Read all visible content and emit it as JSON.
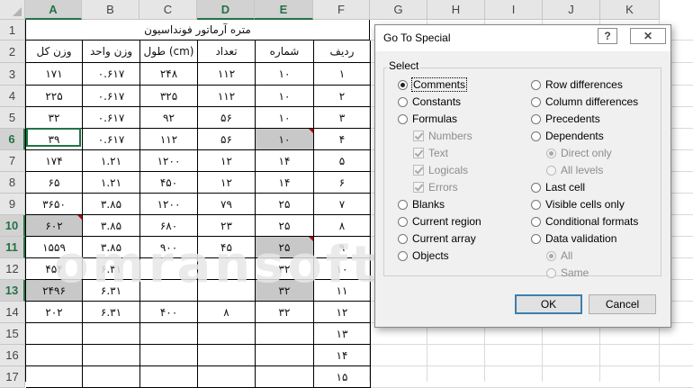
{
  "columns": [
    "A",
    "B",
    "C",
    "D",
    "E",
    "F",
    "G",
    "H",
    "I",
    "J",
    "K"
  ],
  "selected_columns": [
    "A",
    "D",
    "E"
  ],
  "rows": [
    "1",
    "2",
    "3",
    "4",
    "5",
    "6",
    "7",
    "8",
    "9",
    "10",
    "11",
    "12",
    "13",
    "14",
    "15",
    "16",
    "17"
  ],
  "selected_rows": [
    "6",
    "10",
    "11",
    "13"
  ],
  "sheet": {
    "title": "متره آرماتور فونداسیون",
    "headers": [
      "وزن کل",
      "وزن واحد",
      "طول (cm)",
      "تعداد",
      "شماره",
      "ردیف"
    ],
    "data": [
      [
        "۱۷۱",
        "۰.۶۱۷",
        "۲۴۸",
        "۱۱۲",
        "۱۰",
        "۱"
      ],
      [
        "۲۲۵",
        "۰.۶۱۷",
        "۳۲۵",
        "۱۱۲",
        "۱۰",
        "۲"
      ],
      [
        "۳۲",
        "۰.۶۱۷",
        "۹۲",
        "۵۶",
        "۱۰",
        "۳"
      ],
      [
        "۳۹",
        "۰.۶۱۷",
        "۱۱۲",
        "۵۶",
        "۱۰",
        "۴"
      ],
      [
        "۱۷۴",
        "۱.۲۱",
        "۱۲۰۰",
        "۱۲",
        "۱۴",
        "۵"
      ],
      [
        "۶۵",
        "۱.۲۱",
        "۴۵۰",
        "۱۲",
        "۱۴",
        "۶"
      ],
      [
        "۳۶۵۰",
        "۳.۸۵",
        "۱۲۰۰",
        "۷۹",
        "۲۵",
        "۷"
      ],
      [
        "۶۰۲",
        "۳.۸۵",
        "۶۸۰",
        "۲۳",
        "۲۵",
        "۸"
      ],
      [
        "۱۵۵۹",
        "۳.۸۵",
        "۹۰۰",
        "۴۵",
        "۲۵",
        "۹"
      ],
      [
        "۴۵۴",
        "۶.۳۱",
        "",
        "",
        "۳۲",
        "۱۰"
      ],
      [
        "۲۴۹۶",
        "۶.۳۱",
        "",
        "",
        "۳۲",
        "۱۱"
      ],
      [
        "۲۰۲",
        "۶.۳۱",
        "۴۰۰",
        "۸",
        "۳۲",
        "۱۲"
      ],
      [
        "",
        "",
        "",
        "",
        "",
        "۱۳"
      ],
      [
        "",
        "",
        "",
        "",
        "",
        "۱۴"
      ],
      [
        "",
        "",
        "",
        "",
        "",
        "۱۵"
      ]
    ]
  },
  "watermark": "omransoft.ir",
  "dialog": {
    "title": "Go To Special",
    "help_icon": "?",
    "close_icon": "✕",
    "group_label": "Select",
    "left_options": [
      {
        "label": "Comments",
        "state": "selected"
      },
      {
        "label": "Constants",
        "state": "normal"
      },
      {
        "label": "Formulas",
        "state": "normal"
      },
      {
        "label": "Numbers",
        "state": "checkbox-disabled"
      },
      {
        "label": "Text",
        "state": "checkbox-disabled"
      },
      {
        "label": "Logicals",
        "state": "checkbox-disabled"
      },
      {
        "label": "Errors",
        "state": "checkbox-disabled"
      },
      {
        "label": "Blanks",
        "state": "normal"
      },
      {
        "label": "Current region",
        "state": "normal"
      },
      {
        "label": "Current array",
        "state": "normal"
      },
      {
        "label": "Objects",
        "state": "normal"
      }
    ],
    "right_options": [
      {
        "label": "Row differences",
        "state": "normal"
      },
      {
        "label": "Column differences",
        "state": "normal"
      },
      {
        "label": "Precedents",
        "state": "normal"
      },
      {
        "label": "Dependents",
        "state": "normal"
      },
      {
        "label": "Direct only",
        "state": "radio-disabled-on"
      },
      {
        "label": "All levels",
        "state": "radio-disabled"
      },
      {
        "label": "Last cell",
        "state": "normal"
      },
      {
        "label": "Visible cells only",
        "state": "normal"
      },
      {
        "label": "Conditional formats",
        "state": "normal"
      },
      {
        "label": "Data validation",
        "state": "normal"
      },
      {
        "label": "All",
        "state": "radio-disabled-on"
      },
      {
        "label": "Same",
        "state": "radio-disabled"
      }
    ],
    "ok_label": "OK",
    "cancel_label": "Cancel"
  }
}
